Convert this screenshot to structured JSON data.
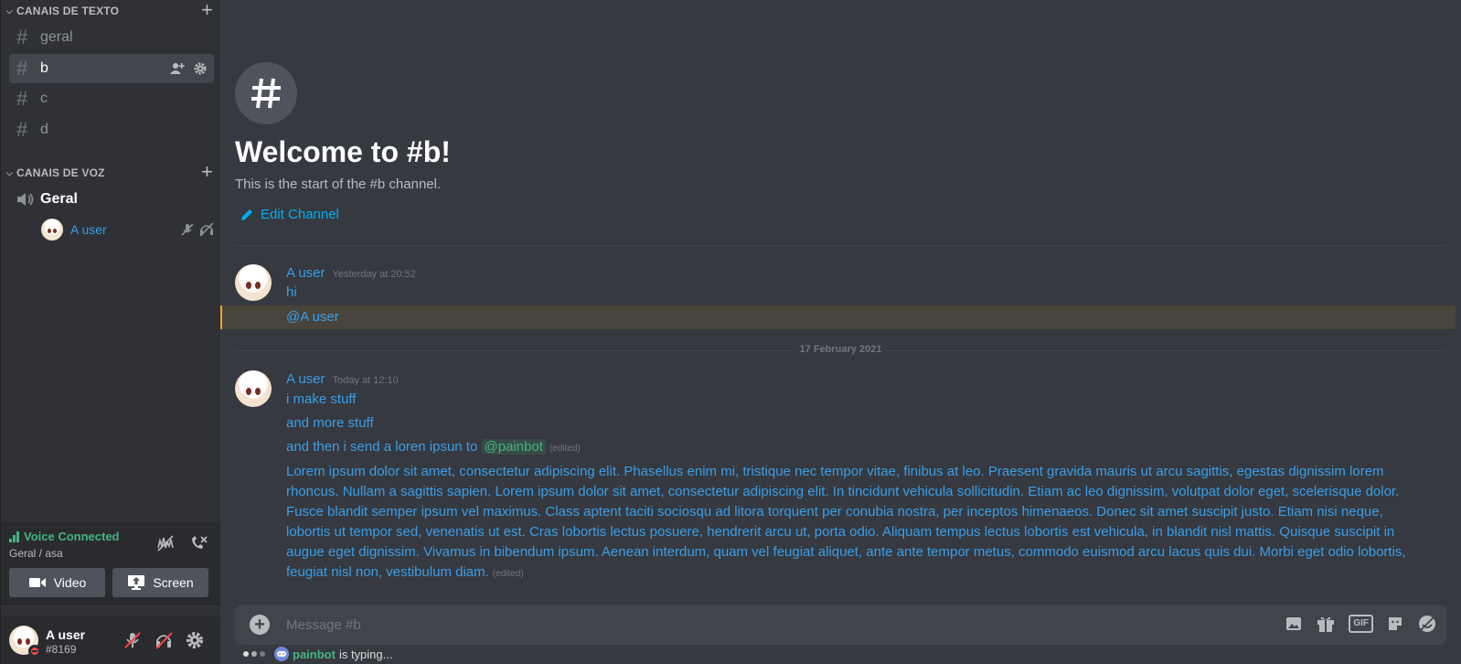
{
  "sidebar": {
    "text_category": "CANAIS DE TEXTO",
    "text_channels": [
      {
        "name": "geral"
      },
      {
        "name": "b"
      },
      {
        "name": "c"
      },
      {
        "name": "d"
      }
    ],
    "voice_category": "CANAIS DE VOZ",
    "voice_channel": "Geral",
    "voice_user": "A user"
  },
  "voice_panel": {
    "status": "Voice Connected",
    "location": "Geral / asa",
    "video_label": "Video",
    "screen_label": "Screen"
  },
  "user_panel": {
    "username": "A user",
    "tag": "#8169"
  },
  "welcome": {
    "title": "Welcome to #b!",
    "subtitle": "This is the start of the #b channel.",
    "edit_label": "Edit Channel"
  },
  "messages": {
    "group1": {
      "author": "A user",
      "time": "Yesterday at 20:52",
      "line1": "hi",
      "line2": "@A user"
    },
    "date_divider": "17 February 2021",
    "group2": {
      "author": "A user",
      "time": "Today at 12:10",
      "line1": "i make stuff",
      "line2": "and more stuff",
      "line3_prefix": "and then i send a loren ipsun to",
      "line3_mention": "@painbot",
      "edited": "(edited)",
      "lorem": "Lorem ipsum dolor sit amet, consectetur adipiscing elit. Phasellus enim mi, tristique nec tempor vitae, finibus at leo. Praesent gravida mauris ut arcu sagittis, egestas dignissim lorem rhoncus. Nullam a sagittis sapien. Lorem ipsum dolor sit amet, consectetur adipiscing elit. In tincidunt vehicula sollicitudin. Etiam ac leo dignissim, volutpat dolor eget, scelerisque dolor. Fusce blandit semper ipsum vel maximus. Class aptent taciti sociosqu ad litora torquent per conubia nostra, per inceptos himenaeos. Donec sit amet suscipit justo. Etiam nisi neque, lobortis ut tempor sed, venenatis ut est. Cras lobortis lectus posuere, hendrerit arcu ut, porta odio. Aliquam tempus lectus lobortis est vehicula, in blandit nisl mattis. Quisque suscipit in augue eget dignissim. Vivamus in bibendum ipsum. Aenean interdum, quam vel feugiat aliquet, ante ante tempor metus, commodo euismod arcu lacus quis dui. Morbi eget odio lobortis, feugiat nisl non, vestibulum diam.",
      "lorem_edited": "(edited)"
    }
  },
  "composer": {
    "placeholder": "Message #b",
    "gif_label": "GIF"
  },
  "typing": {
    "user": "painbot",
    "suffix": "is typing..."
  },
  "colors": {
    "accent_blue": "#3a9ee8",
    "link": "#00b0f4",
    "green": "#43b581",
    "mention_highlight": "#faa61a",
    "dnd": "#f04747"
  }
}
